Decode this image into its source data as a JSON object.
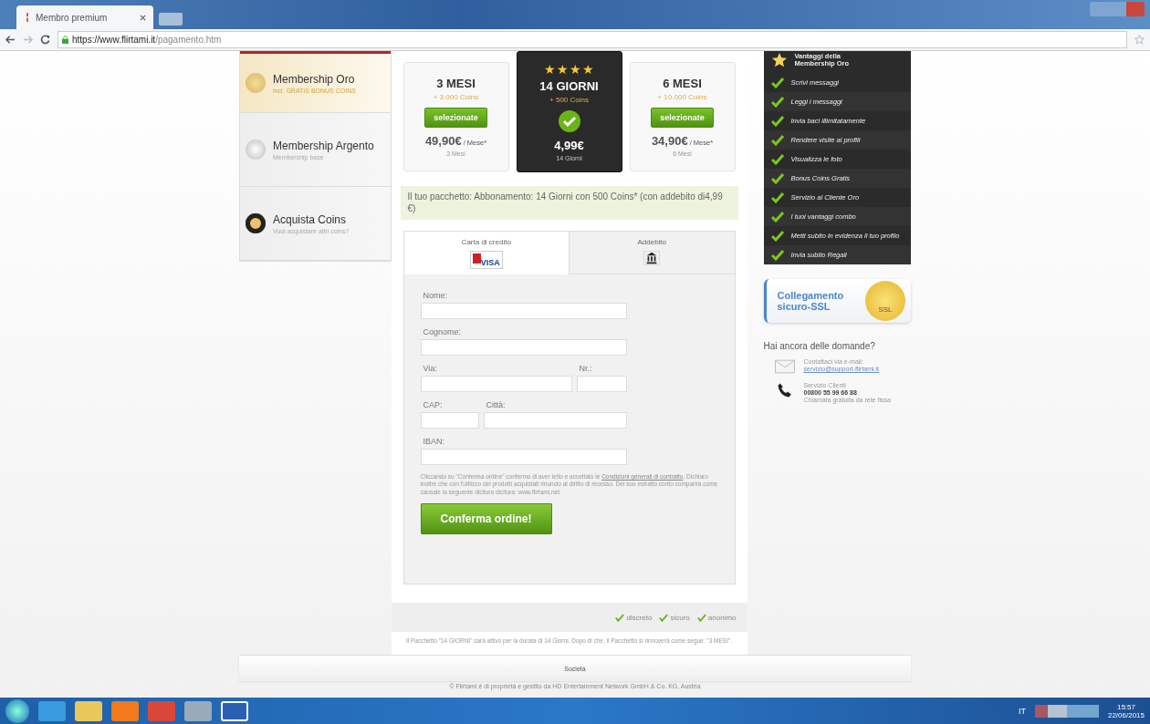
{
  "browser": {
    "tab_title": "Membro premium",
    "url_host": "https://www.flirtami.it",
    "url_path": "/pagamento.htm"
  },
  "sidebar": [
    {
      "kind": "gold",
      "title": "Membership Oro",
      "subtitle": "incl. GRATIS BONUS COINS",
      "selected": true
    },
    {
      "kind": "silver",
      "title": "Membership Argento",
      "subtitle": "Membership base",
      "selected": false
    },
    {
      "kind": "coins",
      "title": "Acquista Coins",
      "subtitle": "Vuoi acquistare altri coins?",
      "selected": false
    }
  ],
  "plans": [
    {
      "name": "3 MESI",
      "coins": "+ 3.000 Coins",
      "button": "selezionate",
      "price": "49,90€",
      "per": "/ Mese*",
      "duration": "3 Mesi",
      "selected": false
    },
    {
      "name": "14 GIORNI",
      "coins": "+ 500 Coins",
      "price": "4,99€",
      "duration": "14 Giorni",
      "selected": true,
      "stars": 4
    },
    {
      "name": "6 MESI",
      "coins": "+ 10.000 Coins",
      "button": "selezionate",
      "price": "34,90€",
      "per": "/ Mese*",
      "duration": "6 Mesi",
      "selected": false
    }
  ],
  "summary": "Il tuo pacchetto: Abbonamento: 14 Giorni con 500 Coins* (con addebito di4,99 €)",
  "payment_tabs": [
    {
      "label": "Carta di credito",
      "kind": "card",
      "logo": "VISA",
      "selected": true
    },
    {
      "label": "Addebito",
      "kind": "debit",
      "selected": false
    }
  ],
  "form": {
    "nome": "Nome:",
    "cognome": "Cognome:",
    "via": "Via:",
    "nr": "Nr.:",
    "cap": "CAP:",
    "citta": "Città:",
    "iban": "IBAN:"
  },
  "legal": {
    "before": "Cliccando su \"Conferma ordine\" confermo di aver letto e accettato le",
    "link": "Condizioni generali di contratto",
    "after": ". Dichiaro inoltre che con l'utilizzo dei prodotti acquistati rinuncio al diritto di recesso. Del suo estratto conto comparirà come causale la seguente dicitura dicitura: www.flirtami.net"
  },
  "confirm_button": "Conferma ordine!",
  "trust": [
    "discreto",
    "sicuro",
    "anonimo"
  ],
  "renewal_note": "Il Pacchetto \"14 GIORNI\" sarà attivo per la durata di 14 Giorni. Dopo di che, il Pacchetto si rinnoverà come segue: \"3 MESI\".",
  "benefits": {
    "title_1": "Vantaggi della",
    "title_2": "Membership Oro",
    "items": [
      "Scrivi messaggi",
      "Leggi i messaggi",
      "Invia baci illimitatamente",
      "Rendere visite ai profili",
      "Visualizza le foto",
      "Bonus Coins Gratis",
      "Servizio al Cliente Oro",
      "I tuoi vantaggi combo",
      "Metti subito in evidenza il tuo profilo",
      "Invia subito Regali"
    ]
  },
  "ssl": {
    "text": "Collegamento sicuro-SSL",
    "seal": "SSL"
  },
  "help": {
    "title": "Hai ancora delle domande?",
    "mail_label": "Contattaci via e-mail:",
    "mail": "servizio@support-flirtami.it",
    "phone_label": "Servizio Clienti",
    "phone": "00800 55 99 66 88",
    "phone_note": "Chiamata gratuita da rete fissa"
  },
  "footer": {
    "link": "Società",
    "copyright": "© Flirtami è di proprietà e gestito da HD Entertainment Network GmbH & Co. KG, Austria"
  },
  "taskbar": {
    "language": "IT",
    "time": "15:57",
    "date": "22/06/2015"
  }
}
